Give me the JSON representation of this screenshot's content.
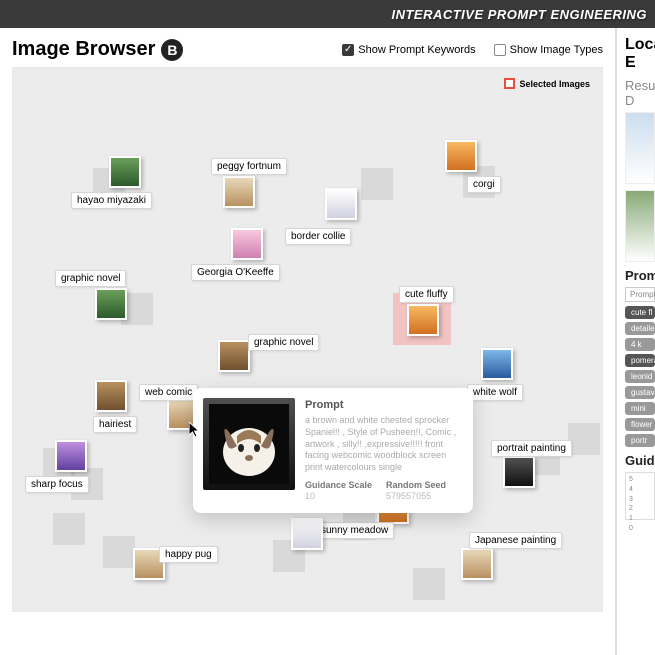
{
  "topbar_title": "INTERACTIVE PROMPT ENGINEERING",
  "left": {
    "title": "Image Browser",
    "badge": "B",
    "chk_keywords": "Show Prompt Keywords",
    "chk_types": "Show Image Types",
    "legend_selected": "Selected Images"
  },
  "nodes": {
    "hayao": "hayao miyazaki",
    "peggy": "peggy fortnum",
    "corgi": "corgi",
    "border": "border collie",
    "okeeffe": "Georgia O'Keeffe",
    "gnovel1": "graphic novel",
    "gnovel2": "graphic novel",
    "cute": "cute fluffy",
    "whitewolf": "white wolf",
    "webcomic": "web comic",
    "hairiest": "hairiest",
    "sharp": "sharp focus",
    "portrait": "portrait painting",
    "sunny": "sunny meadow",
    "japanese": "Japanese painting",
    "happy": "happy pug"
  },
  "tooltip": {
    "h": "Prompt",
    "text": "a brown and white chested sprocker Spaniel!! , Style of Pusheen!!, Comic , artwork , silly!! ,expressive!!!!! front facing webcomic woodblock screen print watercolours single",
    "gs_label": "Guidance Scale",
    "gs_val": "10",
    "seed_label": "Random Seed",
    "seed_val": "579557055"
  },
  "right": {
    "h_local": "Local E",
    "h_result": "Result D",
    "h_prompt": "Prompt",
    "prompt_bar": "Prompt",
    "pills": [
      "cute fl",
      "detailed p",
      "4 k",
      "pomerania",
      "leonid af",
      "gustav",
      "mini",
      "flower m",
      "portr"
    ],
    "h_guidance": "Guidanc",
    "axis": [
      "5",
      "4",
      "3",
      "2",
      "1",
      "0"
    ]
  }
}
